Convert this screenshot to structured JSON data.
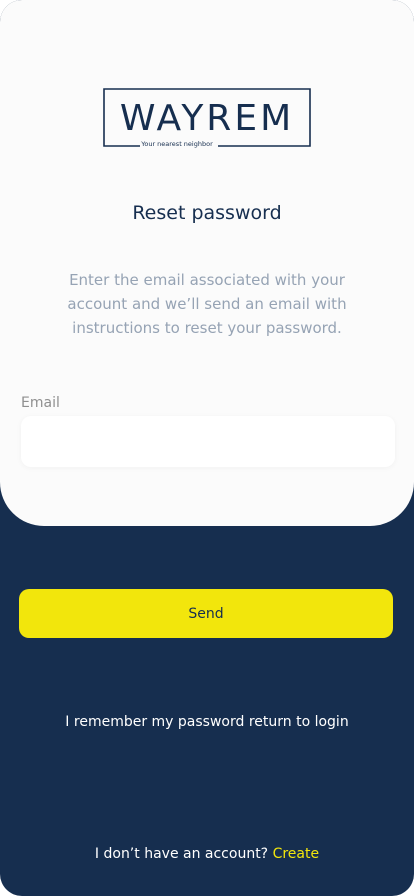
{
  "brand": {
    "name": "WAYREM",
    "tagline": "Your nearest neighbor",
    "logo_color": "#162e4f"
  },
  "header": {
    "title": "Reset password"
  },
  "instructions": {
    "text": "Enter the email associated with your account and we’ll send an email with instructions to reset your password."
  },
  "form": {
    "email_label": "Email",
    "email_value": "",
    "send_label": "Send"
  },
  "links": {
    "return_to_login": "I remember my password return to login",
    "no_account_text": "I don’t have an account?",
    "create_label": "Create"
  },
  "colors": {
    "background": "#162e4f",
    "card": "#fbfbfb",
    "accent": "#f2e60c",
    "muted_text": "#96a3b4"
  }
}
